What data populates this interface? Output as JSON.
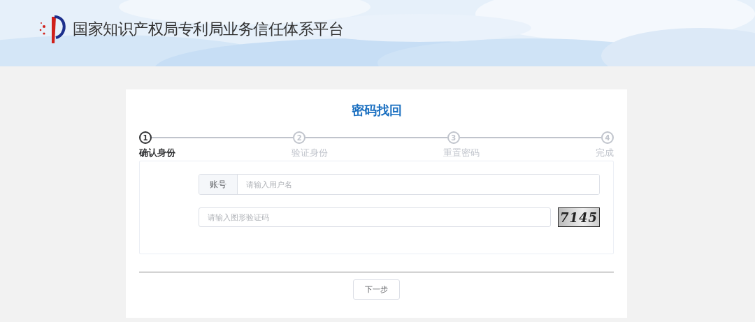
{
  "header": {
    "title": "国家知识产权局专利局业务信任体系平台"
  },
  "card": {
    "title": "密码找回",
    "steps": [
      {
        "number": "1",
        "label": "确认身份",
        "selected": true
      },
      {
        "number": "2",
        "label": "验证身份",
        "selected": false
      },
      {
        "number": "3",
        "label": "重置密码",
        "selected": false
      },
      {
        "number": "4",
        "label": "完成",
        "selected": false
      }
    ],
    "account": {
      "label": "账号",
      "placeholder": "请输入用户名"
    },
    "captcha": {
      "placeholder": "请输入图形验证码",
      "code": "7145"
    },
    "next_button": "下一步"
  }
}
